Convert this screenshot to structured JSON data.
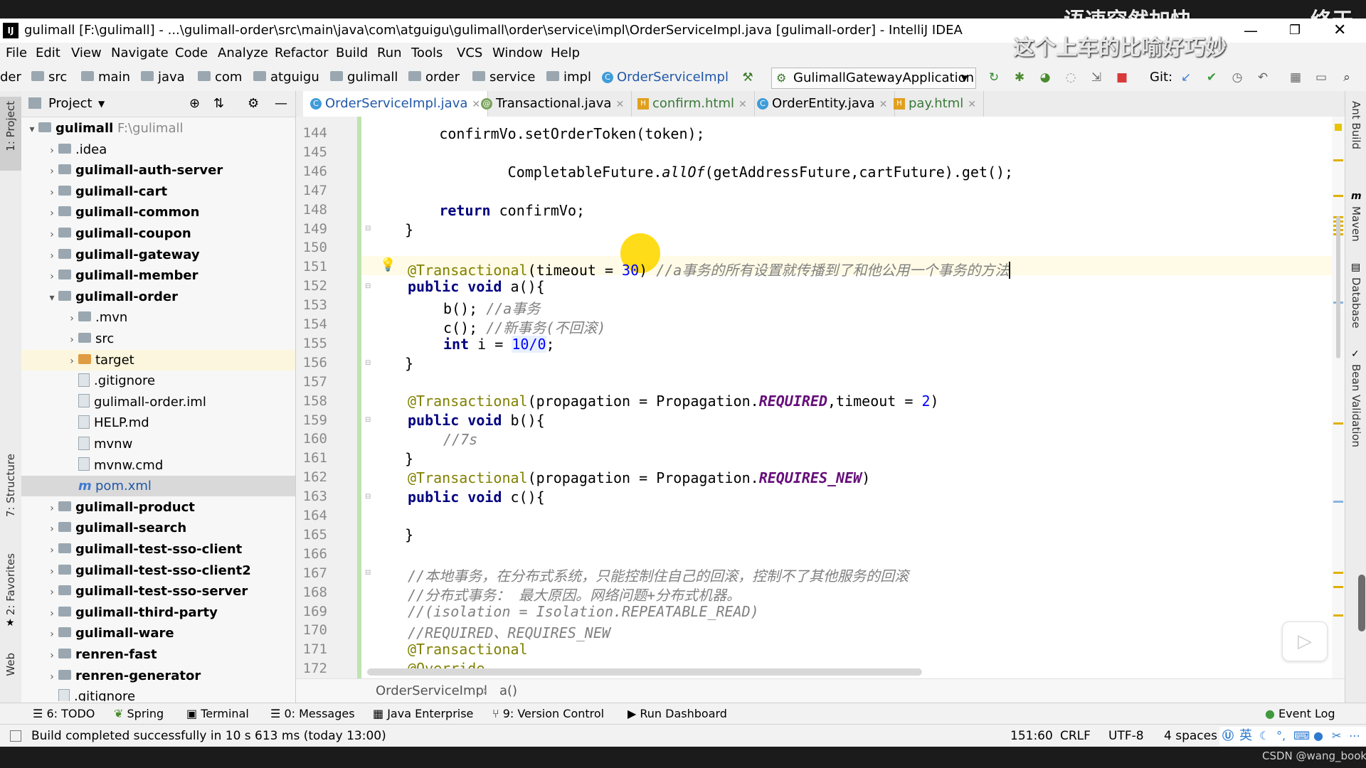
{
  "overlay": {
    "line1": "语速突然加快",
    "line2": "这个上车的比喻好巧妙",
    "corner": "终于明"
  },
  "window": {
    "title": "gulimall [F:\\gulimall] - ...\\gulimall-order\\src\\main\\java\\com\\atguigu\\gulimall\\order\\service\\impl\\OrderServiceImpl.java [gulimall-order] - IntelliJ IDEA"
  },
  "menu": [
    "File",
    "Edit",
    "View",
    "Navigate",
    "Code",
    "Analyze",
    "Refactor",
    "Build",
    "Run",
    "Tools",
    "VCS",
    "Window",
    "Help"
  ],
  "breadcrumb": [
    "der",
    "src",
    "main",
    "java",
    "com",
    "atguigu",
    "gulimall",
    "order",
    "service",
    "impl",
    "OrderServiceImpl"
  ],
  "run_config": "GulimallGatewayApplication",
  "git_label": "Git:",
  "project_panel": {
    "title": "Project"
  },
  "tree": [
    {
      "label": "gulimall",
      "path": "F:\\gulimall",
      "indent": 0,
      "arrow": "▾",
      "kind": "folder"
    },
    {
      "label": ".idea",
      "indent": 1,
      "arrow": "›",
      "kind": "folder",
      "light": true
    },
    {
      "label": "gulimall-auth-server",
      "indent": 1,
      "arrow": "›",
      "kind": "folder"
    },
    {
      "label": "gulimall-cart",
      "indent": 1,
      "arrow": "›",
      "kind": "folder"
    },
    {
      "label": "gulimall-common",
      "indent": 1,
      "arrow": "›",
      "kind": "folder"
    },
    {
      "label": "gulimall-coupon",
      "indent": 1,
      "arrow": "›",
      "kind": "folder"
    },
    {
      "label": "gulimall-gateway",
      "indent": 1,
      "arrow": "›",
      "kind": "folder"
    },
    {
      "label": "gulimall-member",
      "indent": 1,
      "arrow": "›",
      "kind": "folder"
    },
    {
      "label": "gulimall-order",
      "indent": 1,
      "arrow": "▾",
      "kind": "folder"
    },
    {
      "label": ".mvn",
      "indent": 2,
      "arrow": "›",
      "kind": "folder",
      "light": true
    },
    {
      "label": "src",
      "indent": 2,
      "arrow": "›",
      "kind": "folder",
      "light": true
    },
    {
      "label": "target",
      "indent": 2,
      "arrow": "›",
      "kind": "folder-orange",
      "light": true
    },
    {
      "label": ".gitignore",
      "indent": 2,
      "arrow": "",
      "kind": "file",
      "light": true
    },
    {
      "label": "gulimall-order.iml",
      "indent": 2,
      "arrow": "",
      "kind": "file",
      "light": true
    },
    {
      "label": "HELP.md",
      "indent": 2,
      "arrow": "",
      "kind": "file",
      "light": true
    },
    {
      "label": "mvnw",
      "indent": 2,
      "arrow": "",
      "kind": "file",
      "light": true
    },
    {
      "label": "mvnw.cmd",
      "indent": 2,
      "arrow": "",
      "kind": "file",
      "light": true
    },
    {
      "label": "pom.xml",
      "indent": 2,
      "arrow": "",
      "kind": "maven",
      "light": true,
      "selected": true
    },
    {
      "label": "gulimall-product",
      "indent": 1,
      "arrow": "›",
      "kind": "folder"
    },
    {
      "label": "gulimall-search",
      "indent": 1,
      "arrow": "›",
      "kind": "folder"
    },
    {
      "label": "gulimall-test-sso-client",
      "indent": 1,
      "arrow": "›",
      "kind": "folder"
    },
    {
      "label": "gulimall-test-sso-client2",
      "indent": 1,
      "arrow": "›",
      "kind": "folder"
    },
    {
      "label": "gulimall-test-sso-server",
      "indent": 1,
      "arrow": "›",
      "kind": "folder"
    },
    {
      "label": "gulimall-third-party",
      "indent": 1,
      "arrow": "›",
      "kind": "folder"
    },
    {
      "label": "gulimall-ware",
      "indent": 1,
      "arrow": "›",
      "kind": "folder"
    },
    {
      "label": "renren-fast",
      "indent": 1,
      "arrow": "›",
      "kind": "folder"
    },
    {
      "label": "renren-generator",
      "indent": 1,
      "arrow": "›",
      "kind": "folder"
    },
    {
      "label": ".gitignore",
      "indent": 1,
      "arrow": "",
      "kind": "file",
      "light": true
    }
  ],
  "tabs": [
    {
      "label": "OrderServiceImpl.java",
      "icon": "C",
      "active": true
    },
    {
      "label": "Transactional.java",
      "icon": "@"
    },
    {
      "label": "confirm.html",
      "icon": "H"
    },
    {
      "label": "OrderEntity.java",
      "icon": "C"
    },
    {
      "label": "pay.html",
      "icon": "H"
    }
  ],
  "line_numbers": [
    "144",
    "145",
    "146",
    "147",
    "148",
    "149",
    "150",
    "151",
    "152",
    "153",
    "154",
    "155",
    "156",
    "157",
    "158",
    "159",
    "160",
    "161",
    "162",
    "163",
    "164",
    "165",
    "166",
    "167",
    "168",
    "169",
    "170",
    "171",
    "172"
  ],
  "code": {
    "l144": "        confirmVo.setOrderToken(token);",
    "l146": "        CompletableFuture.",
    "l146b": "allOf",
    "l146c": "(getAddressFuture,cartFuture).get();",
    "l148a": "return",
    "l148b": " confirmVo;",
    "l149": "    }",
    "l151a": "@Transactional",
    "l151b": "(timeout = ",
    "l151c": "30",
    "l151d": ") ",
    "l151e": "//a事务的所有设置就传播到了和他公用一个事务的方法",
    "l152a": "public void ",
    "l152b": "a(){",
    "l153a": "b(); ",
    "l153b": "//a事务",
    "l154a": "c(); ",
    "l154b": "//新事务(不回滚)",
    "l155a": "int ",
    "l155b": "i = ",
    "l155c": "10/0",
    "l155d": ";",
    "l156": "    }",
    "l158a": "@Transactional",
    "l158b": "(propagation = Propagation.",
    "l158c": "REQUIRED",
    "l158d": ",timeout = ",
    "l158e": "2",
    "l158f": ")",
    "l159a": "public void ",
    "l159b": "b(){",
    "l160": "//7s",
    "l161": "    }",
    "l162a": "@Transactional",
    "l162b": "(propagation = Propagation.",
    "l162c": "REQUIRES_NEW",
    "l162d": ")",
    "l163a": "public void ",
    "l163b": "c(){",
    "l165": "    }",
    "l167": "//本地事务，在分布式系统，只能控制住自己的回滚，控制不了其他服务的回滚",
    "l168": "//分布式事务： 最大原因。网络问题+分布式机器。",
    "l169": "//(isolation = Isolation.REPEATABLE_READ)",
    "l170": "//REQUIRED、REQUIRES_NEW",
    "l171": "@Transactional",
    "l172": "@Override"
  },
  "editor_breadcrumb": [
    "OrderServiceImpl",
    "a()"
  ],
  "tool_windows": [
    "6: TODO",
    "Spring",
    "Terminal",
    "0: Messages",
    "Java Enterprise",
    "9: Version Control",
    "Run Dashboard",
    "Event Log"
  ],
  "left_strip": [
    "1: Project",
    "7: Structure",
    "2: Favorites",
    "Web"
  ],
  "right_strip": [
    "Ant Build",
    "Maven",
    "Database",
    "Bean Validation"
  ],
  "status": {
    "message": "Build completed successfully in 10 s 613 ms (today 13:00)",
    "position": "151:60",
    "line_sep": "CRLF",
    "encoding": "UTF-8",
    "indent": "4 spaces",
    "ime": "英"
  },
  "watermark": "CSDN @wang_book",
  "colors": {
    "accent": "#4083c9",
    "keyword": "#000080",
    "annotation": "#808000",
    "comment": "#808080",
    "number": "#0000ff",
    "constant": "#660e7a",
    "cursor_highlight": "#ffd800"
  }
}
